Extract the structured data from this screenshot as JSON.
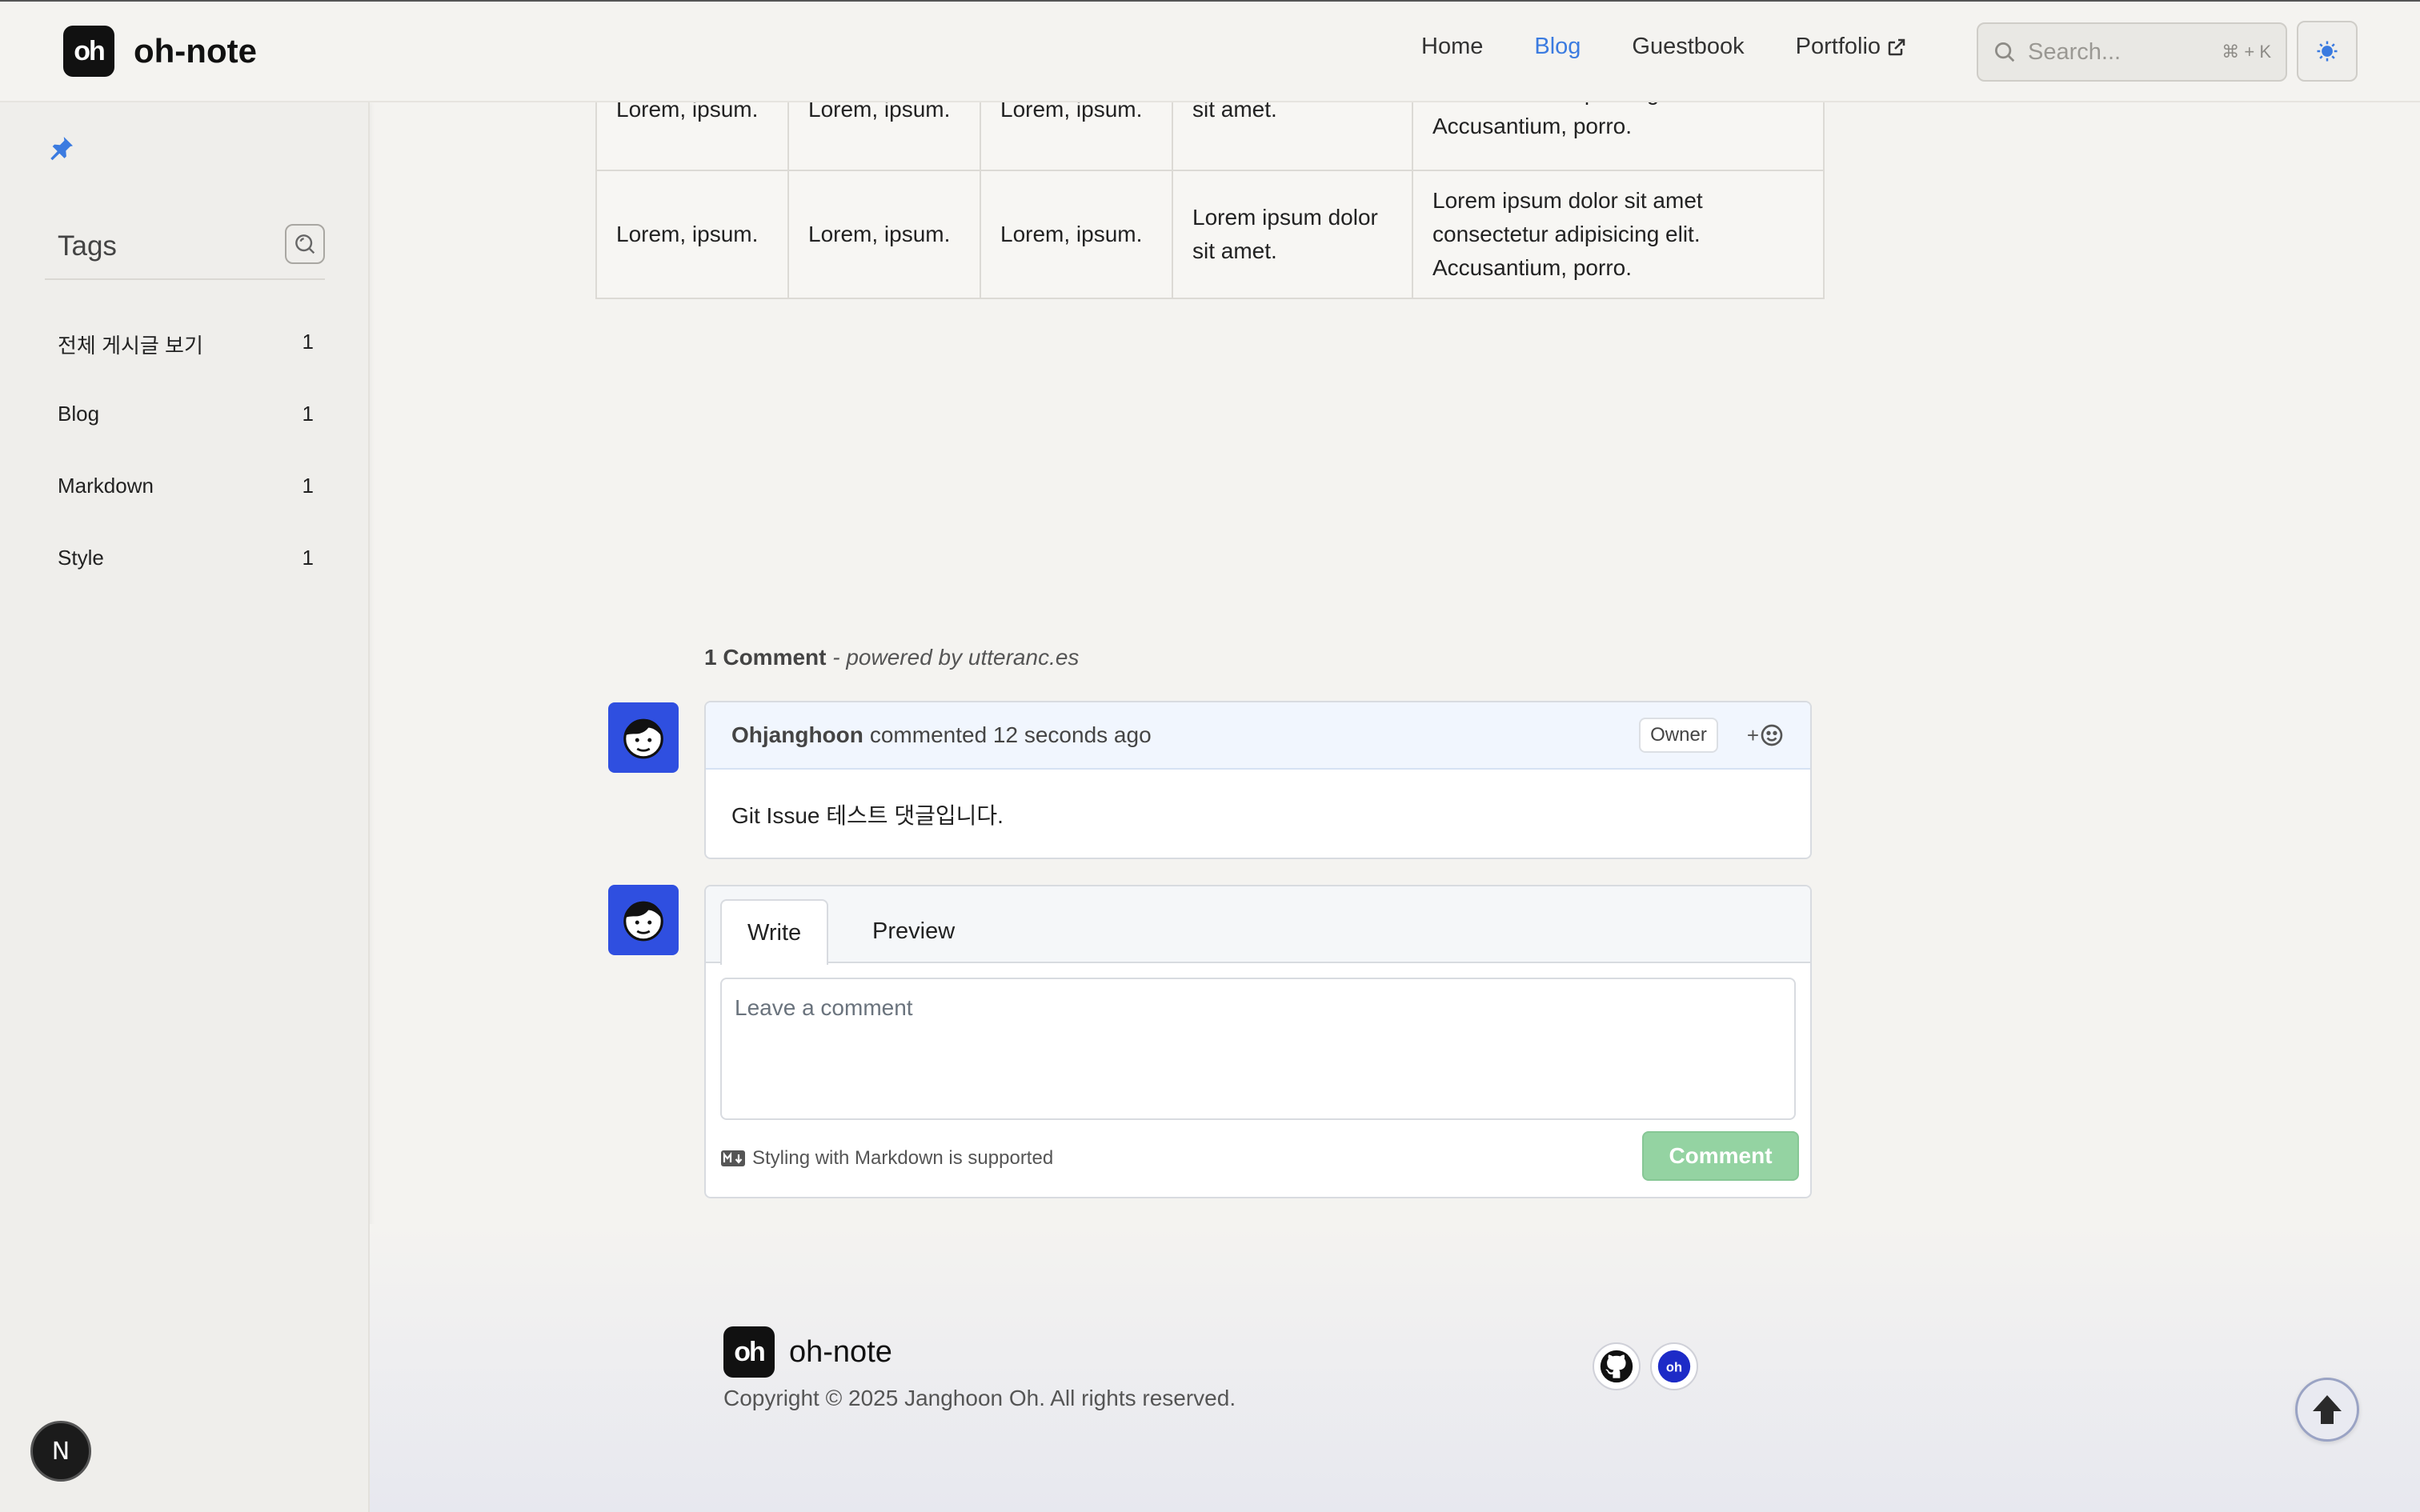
{
  "header": {
    "logo_mark": "oh",
    "site_name": "oh-note",
    "nav": [
      "Home",
      "Blog",
      "Guestbook",
      "Portfolio"
    ],
    "active_nav": "Blog",
    "search_placeholder": "Search...",
    "search_shortcut": "⌘ + K",
    "accent_color": "#3b7be0"
  },
  "sidebar": {
    "tags_title": "Tags",
    "tags": [
      {
        "label": "전체 게시글 보기",
        "count": "1"
      },
      {
        "label": "Blog",
        "count": "1"
      },
      {
        "label": "Markdown",
        "count": "1"
      },
      {
        "label": "Style",
        "count": "1"
      }
    ]
  },
  "table": {
    "rows": [
      [
        "Lorem, ipsum.",
        "Lorem, ipsum.",
        "Lorem, ipsum.",
        "sit amet.",
        "consectetur adipisicing elit. Accusantium, porro."
      ],
      [
        "Lorem, ipsum.",
        "Lorem, ipsum.",
        "Lorem, ipsum.",
        "Lorem ipsum dolor sit amet.",
        "Lorem ipsum dolor sit amet consectetur adipisicing elit. Accusantium, porro."
      ]
    ]
  },
  "comments": {
    "count_label": "1 Comment",
    "powered_by": "- powered by utteranc.es",
    "items": [
      {
        "author": "Ohjanghoon",
        "meta": "commented 12 seconds ago",
        "badge": "Owner",
        "body": "Git Issue 테스트 댓글입니다."
      }
    ],
    "react_label": "+",
    "editor": {
      "tab_write": "Write",
      "tab_preview": "Preview",
      "placeholder": "Leave a comment",
      "markdown_hint": "Styling with Markdown is supported",
      "submit": "Comment"
    }
  },
  "footer": {
    "site_name": "oh-note",
    "copyright": "Copyright © 2025 Janghoon Oh. All rights reserved.",
    "social": [
      "github-icon",
      "oh-icon"
    ]
  },
  "floating": {
    "next_badge": "N"
  }
}
